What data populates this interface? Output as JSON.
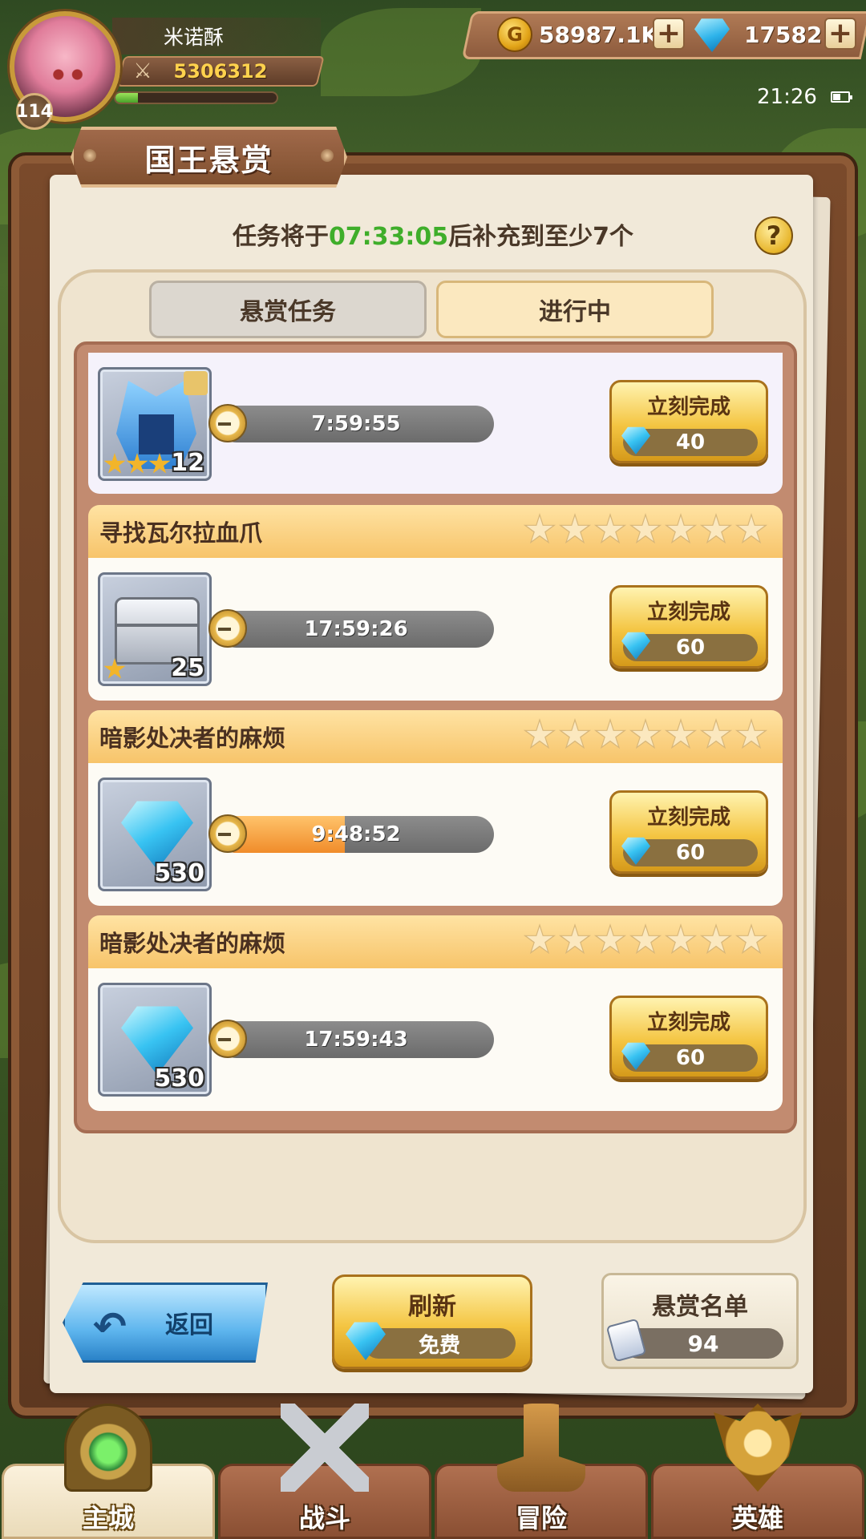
{
  "player": {
    "name": "米诺酥",
    "level": "114",
    "power": "5306312",
    "exp_fraction": 0.14
  },
  "resources": {
    "gold": "58987.1K",
    "gems": "17582"
  },
  "status_bar": {
    "time": "21:26"
  },
  "board": {
    "title": "国王悬赏",
    "refresh_prefix": "任务将于",
    "refresh_time": "07:33:05",
    "refresh_suffix": "后补充到至少7个",
    "help_symbol": "?",
    "timer_color": "#3fae2a"
  },
  "tabs": [
    {
      "label": "悬赏任务",
      "active": false
    },
    {
      "label": "进行中",
      "active": true
    }
  ],
  "quests": [
    {
      "title": "",
      "stars_total": 7,
      "item": "helmet",
      "item_stars": 3,
      "qty": "12",
      "timer": "7:59:55",
      "progress": 0.0,
      "finish_label": "立刻完成",
      "cost": "40"
    },
    {
      "title": "寻找瓦尔拉血爪",
      "stars_total": 7,
      "item": "chest",
      "item_stars": 1,
      "qty": "25",
      "timer": "17:59:26",
      "progress": 0.0,
      "finish_label": "立刻完成",
      "cost": "60"
    },
    {
      "title": "暗影处决者的麻烦",
      "stars_total": 7,
      "item": "gem",
      "item_stars": 0,
      "qty": "530",
      "timer": "9:48:52",
      "progress": 0.46,
      "finish_label": "立刻完成",
      "cost": "60"
    },
    {
      "title": "暗影处决者的麻烦",
      "stars_total": 7,
      "item": "gem",
      "item_stars": 0,
      "qty": "530",
      "timer": "17:59:43",
      "progress": 0.0,
      "finish_label": "立刻完成",
      "cost": "60"
    }
  ],
  "actions": {
    "back_label": "返回",
    "refresh_label": "刷新",
    "refresh_cost": "免费",
    "roster_label": "悬赏名单",
    "roster_count": "94"
  },
  "nav": [
    {
      "label": "主城",
      "icon": "city-icon",
      "active": true
    },
    {
      "label": "战斗",
      "icon": "battle-icon",
      "active": false
    },
    {
      "label": "冒险",
      "icon": "adventure-icon",
      "active": false
    },
    {
      "label": "英雄",
      "icon": "hero-icon",
      "active": false
    }
  ]
}
